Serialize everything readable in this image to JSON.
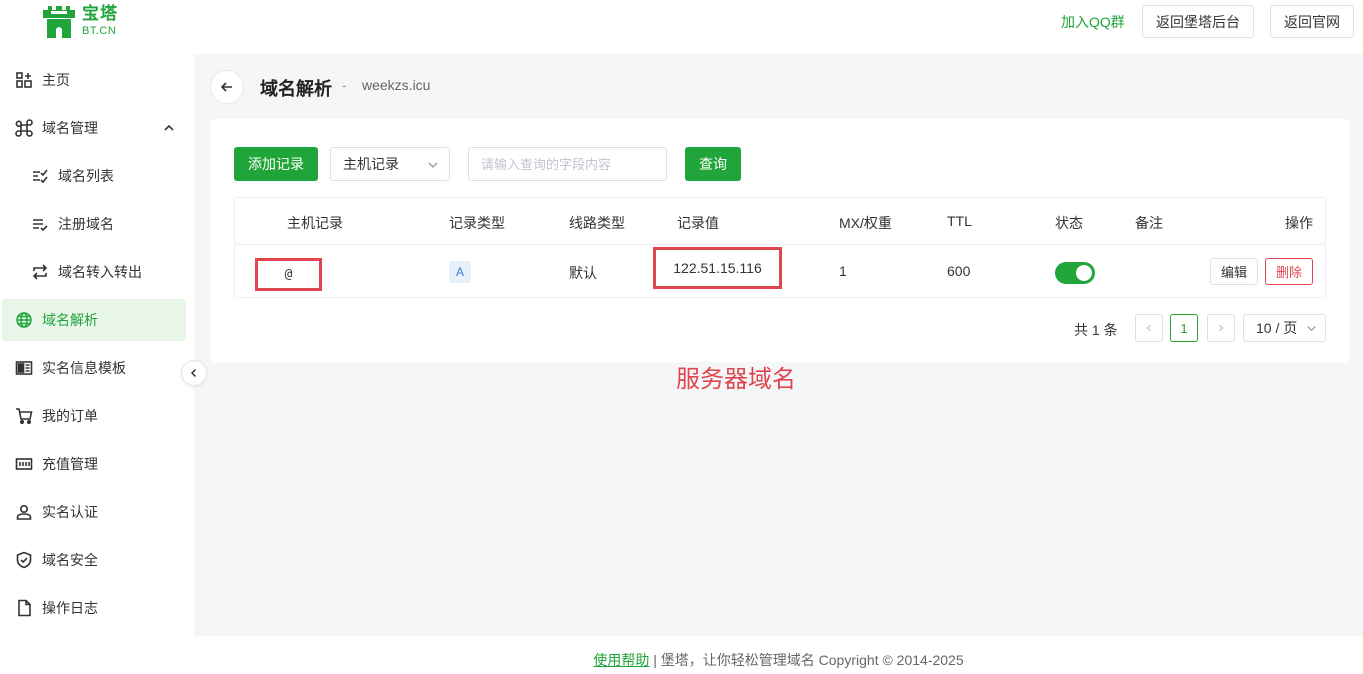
{
  "brand": {
    "name_cn": "宝塔",
    "name_en": "BT.CN"
  },
  "header": {
    "join_qq": "加入QQ群",
    "back_panel": "返回堡塔后台",
    "back_site": "返回官网"
  },
  "sidebar": {
    "items": [
      {
        "label": "主页",
        "icon": "grid-icon"
      },
      {
        "label": "域名管理",
        "icon": "command-icon",
        "expanded": true
      },
      {
        "label": "域名列表",
        "icon": "list-check-icon"
      },
      {
        "label": "注册域名",
        "icon": "list-add-icon"
      },
      {
        "label": "域名转入转出",
        "icon": "transfer-icon"
      },
      {
        "label": "域名解析",
        "icon": "globe-icon",
        "active": true
      },
      {
        "label": "实名信息模板",
        "icon": "id-card-icon"
      },
      {
        "label": "我的订单",
        "icon": "cart-icon"
      },
      {
        "label": "充值管理",
        "icon": "wallet-icon"
      },
      {
        "label": "实名认证",
        "icon": "user-icon"
      },
      {
        "label": "域名安全",
        "icon": "shield-icon"
      },
      {
        "label": "操作日志",
        "icon": "file-icon"
      }
    ]
  },
  "page": {
    "title": "域名解析",
    "separator": "-",
    "domain": "weekzs.icu"
  },
  "toolbar": {
    "add_record": "添加记录",
    "filter_field": "主机记录",
    "search_placeholder": "请输入查询的字段内容",
    "query": "查询"
  },
  "table": {
    "columns": [
      "主机记录",
      "记录类型",
      "线路类型",
      "记录值",
      "MX/权重",
      "TTL",
      "状态",
      "备注",
      "操作"
    ],
    "rows": [
      {
        "host": "@",
        "type": "A",
        "line": "默认",
        "value": "122.51.15.116",
        "mx": "1",
        "ttl": "600",
        "status_on": true,
        "note": "",
        "edit": "编辑",
        "delete": "删除"
      }
    ]
  },
  "pagination": {
    "total": "共 1 条",
    "current_page": "1",
    "page_size": "10 / 页"
  },
  "annotation": "服务器域名",
  "footer": {
    "help": "使用帮助",
    "text": " | 堡塔，让你轻松管理域名 Copyright © 2014-2025"
  },
  "colors": {
    "accent": "#20a53a",
    "danger": "#e0474d"
  }
}
